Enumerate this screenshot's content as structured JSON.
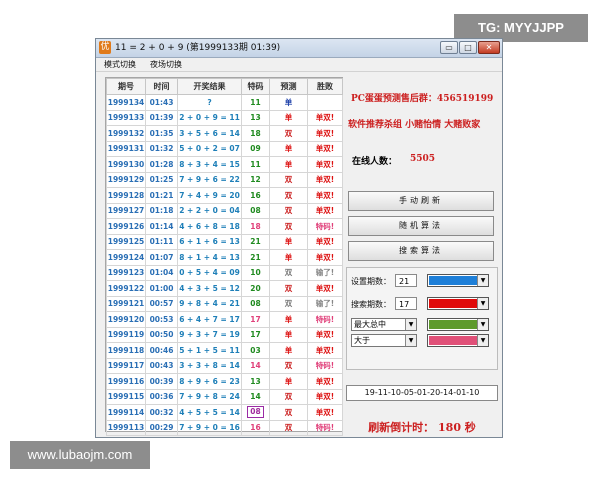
{
  "watermarks": {
    "top": "TG: MYYJJPP",
    "bottom": "www.lubaojm.com"
  },
  "window": {
    "app_icon_char": "优",
    "title": "11 = 2 + 0 + 9 (第1999133期 01:39)",
    "buttons": {
      "minimize": "▭",
      "maximize": "□",
      "close": "✕"
    }
  },
  "menu": {
    "mode": "模式切换",
    "night": "夜场切换"
  },
  "table": {
    "headers": [
      "期号",
      "时间",
      "开奖结果",
      "特码",
      "预测",
      "胜败"
    ],
    "rows": [
      {
        "issue": "1999134",
        "time": "01:43",
        "result": "?",
        "spec": "11",
        "pred": "单",
        "outcome": ""
      },
      {
        "issue": "1999133",
        "time": "01:39",
        "result": "2 + 0 + 9 = 11",
        "spec": "13",
        "pred": "单",
        "outcome": "单双!"
      },
      {
        "issue": "1999132",
        "time": "01:35",
        "result": "3 + 5 + 6 = 14",
        "spec": "18",
        "pred": "双",
        "outcome": "单双!"
      },
      {
        "issue": "1999131",
        "time": "01:32",
        "result": "5 + 0 + 2 = 07",
        "spec": "09",
        "pred": "单",
        "outcome": "单双!"
      },
      {
        "issue": "1999130",
        "time": "01:28",
        "result": "8 + 3 + 4 = 15",
        "spec": "11",
        "pred": "单",
        "outcome": "单双!"
      },
      {
        "issue": "1999129",
        "time": "01:25",
        "result": "7 + 9 + 6 = 22",
        "spec": "12",
        "pred": "双",
        "outcome": "单双!"
      },
      {
        "issue": "1999128",
        "time": "01:21",
        "result": "7 + 4 + 9 = 20",
        "spec": "16",
        "pred": "双",
        "outcome": "单双!"
      },
      {
        "issue": "1999127",
        "time": "01:18",
        "result": "2 + 2 + 0 = 04",
        "spec": "08",
        "pred": "双",
        "outcome": "单双!"
      },
      {
        "issue": "1999126",
        "time": "01:14",
        "result": "4 + 6 + 8 = 18",
        "spec": "18",
        "pred": "双",
        "outcome": "特码!"
      },
      {
        "issue": "1999125",
        "time": "01:11",
        "result": "6 + 1 + 6 = 13",
        "spec": "21",
        "pred": "单",
        "outcome": "单双!"
      },
      {
        "issue": "1999124",
        "time": "01:07",
        "result": "8 + 1 + 4 = 13",
        "spec": "21",
        "pred": "单",
        "outcome": "单双!"
      },
      {
        "issue": "1999123",
        "time": "01:04",
        "result": "0 + 5 + 4 = 09",
        "spec": "10",
        "pred": "双",
        "outcome": "输了!"
      },
      {
        "issue": "1999122",
        "time": "01:00",
        "result": "4 + 3 + 5 = 12",
        "spec": "20",
        "pred": "双",
        "outcome": "单双!"
      },
      {
        "issue": "1999121",
        "time": "00:57",
        "result": "9 + 8 + 4 = 21",
        "spec": "08",
        "pred": "双",
        "outcome": "输了!"
      },
      {
        "issue": "1999120",
        "time": "00:53",
        "result": "6 + 4 + 7 = 17",
        "spec": "17",
        "pred": "单",
        "outcome": "特码!"
      },
      {
        "issue": "1999119",
        "time": "00:50",
        "result": "9 + 3 + 7 = 19",
        "spec": "17",
        "pred": "单",
        "outcome": "单双!"
      },
      {
        "issue": "1999118",
        "time": "00:46",
        "result": "5 + 1 + 5 = 11",
        "spec": "03",
        "pred": "单",
        "outcome": "单双!"
      },
      {
        "issue": "1999117",
        "time": "00:43",
        "result": "3 + 3 + 8 = 14",
        "spec": "14",
        "pred": "双",
        "outcome": "特码!"
      },
      {
        "issue": "1999116",
        "time": "00:39",
        "result": "8 + 9 + 6 = 23",
        "spec": "13",
        "pred": "单",
        "outcome": "单双!"
      },
      {
        "issue": "1999115",
        "time": "00:36",
        "result": "7 + 9 + 8 = 24",
        "spec": "14",
        "pred": "双",
        "outcome": "单双!"
      },
      {
        "issue": "1999114",
        "time": "00:32",
        "result": "4 + 5 + 5 = 14",
        "spec": "08",
        "pred": "双",
        "outcome": "单双!"
      },
      {
        "issue": "1999113",
        "time": "00:29",
        "result": "7 + 9 + 0 = 16",
        "spec": "16",
        "pred": "双",
        "outcome": "特码!"
      }
    ]
  },
  "info": {
    "qq_group": "PC蛋蛋预测售后群：456519199",
    "recommend": "软件推荐杀组  小赌怡情  大赌败家",
    "online_label": "在线人数：",
    "online_count": "5505"
  },
  "actions": {
    "refresh": "手动刷新",
    "random": "随机算法",
    "search": "搜索算法"
  },
  "settings": {
    "periods_label": "设置期数：",
    "periods_value": "21",
    "search_label": "搜索期数：",
    "search_value": "17",
    "dropdown1": "最大总中",
    "dropdown2": "大于",
    "colors": [
      "#1e7fd8",
      "#e00b0b",
      "#5e9a2c",
      "#e05078"
    ]
  },
  "numbers": "19-11-10-05-01-20-14-01-10",
  "countdown": "刷新倒计时：  180  秒"
}
